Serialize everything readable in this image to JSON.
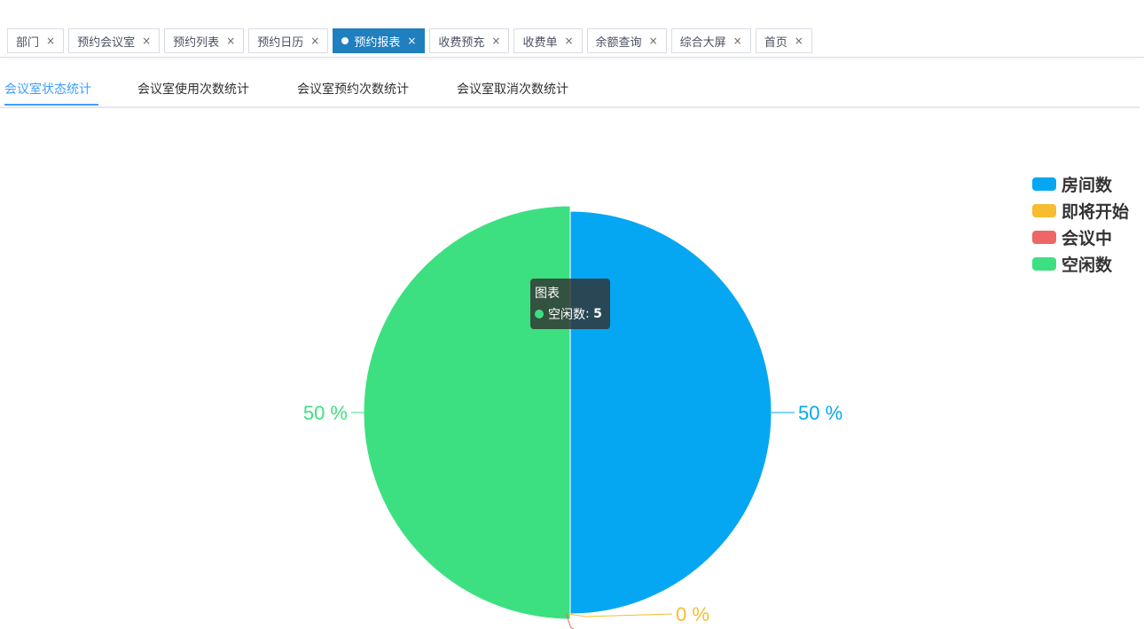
{
  "tabs": [
    {
      "label": "部门",
      "active": false
    },
    {
      "label": "预约会议室",
      "active": false
    },
    {
      "label": "预约列表",
      "active": false
    },
    {
      "label": "预约日历",
      "active": false
    },
    {
      "label": "预约报表",
      "active": true
    },
    {
      "label": "收费预充",
      "active": false
    },
    {
      "label": "收费单",
      "active": false
    },
    {
      "label": "余额查询",
      "active": false
    },
    {
      "label": "综合大屏",
      "active": false
    },
    {
      "label": "首页",
      "active": false
    }
  ],
  "close_glyph": "×",
  "subtabs": [
    {
      "label": "会议室状态统计",
      "active": true
    },
    {
      "label": "会议室使用次数统计",
      "active": false
    },
    {
      "label": "会议室预约次数统计",
      "active": false
    },
    {
      "label": "会议室取消次数统计",
      "active": false
    }
  ],
  "chart_data": {
    "type": "pie",
    "series_name": "图表",
    "categories": [
      "房间数",
      "即将开始",
      "会议中",
      "空闲数"
    ],
    "values": [
      5,
      0,
      0,
      5
    ],
    "colors": [
      "#05a7f2",
      "#f6bd30",
      "#ee6666",
      "#3de080"
    ],
    "labels": [
      "50 %",
      "0 %",
      "0 %",
      "50 %"
    ],
    "legend_position": "top-right",
    "tooltip": {
      "title": "图表",
      "category": "空闲数",
      "value": 5
    }
  }
}
